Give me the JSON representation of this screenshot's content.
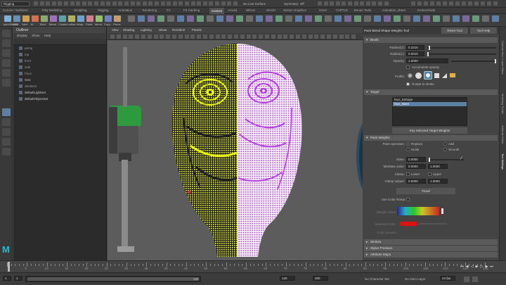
{
  "status_line": {
    "menuset": "Rigging",
    "items": [
      {
        "label": "No Live Surface"
      },
      {
        "label": "Symmetry: Off"
      }
    ]
  },
  "shelf_tabs": [
    {
      "label": "Curves / Surfaces"
    },
    {
      "label": "Poly Modeling"
    },
    {
      "label": "Sculpting"
    },
    {
      "label": "Rigging"
    },
    {
      "label": "Animation"
    },
    {
      "label": "Rendering"
    },
    {
      "label": "FX"
    },
    {
      "label": "FX Caching"
    },
    {
      "label": "Custom",
      "active": true
    },
    {
      "label": "Arnold"
    },
    {
      "label": "Bifrost"
    },
    {
      "label": "MASH"
    },
    {
      "label": "Motion Graphics"
    },
    {
      "label": "XGen"
    },
    {
      "label": "TURTLE"
    },
    {
      "label": "Bonus Tools"
    },
    {
      "label": "Animation_sheet"
    },
    {
      "label": "Embershade"
    }
  ],
  "shelf": [
    {
      "label": "paintSkinWt",
      "color": "#7fb0d8"
    },
    {
      "label": "MEL",
      "color": "#6a8fb2"
    },
    {
      "label": "Joint",
      "color": "#d0a050"
    },
    {
      "label": "IK",
      "color": "#d07050"
    },
    {
      "label": "Bind",
      "color": "#8aa870"
    },
    {
      "label": "Blend",
      "color": "#a070c0"
    },
    {
      "label": "Cluster",
      "color": "#60a0a0"
    },
    {
      "label": "Lattice",
      "color": "#b0b060"
    },
    {
      "label": "Wrap",
      "color": "#70a0d0"
    },
    {
      "label": "Paint",
      "color": "#d08090"
    },
    {
      "label": "Mirror",
      "color": "#90c070"
    },
    {
      "label": "Copy",
      "color": "#7080c0"
    },
    {
      "label": "Prune",
      "color": "#c0a070"
    }
  ],
  "outliner": {
    "title": "Outliner",
    "menu": [
      "Display",
      "Show",
      "Help"
    ],
    "rows": [
      {
        "label": "persp",
        "bright": false
      },
      {
        "label": "top",
        "bright": false
      },
      {
        "label": "front",
        "bright": false
      },
      {
        "label": "side",
        "bright": false
      },
      {
        "label": "Face",
        "bright": false
      },
      {
        "label": "Geo",
        "bright": true
      },
      {
        "label": "Skeleton",
        "bright": false
      },
      {
        "label": "defaultLightSet",
        "bright": true
      },
      {
        "label": "defaultObjectSet",
        "bright": true
      }
    ]
  },
  "viewport": {
    "menu": [
      "View",
      "Shading",
      "Lighting",
      "Show",
      "Renderer",
      "Panels"
    ]
  },
  "tool_settings": {
    "title": "Paint Blend Shape Weights Tool",
    "reset_label": "Reset Tool",
    "help_label": "Tool Help",
    "brush": {
      "header": "Brush",
      "radius_u_label": "Radius(U):",
      "radius_u": "0.2216",
      "radius_l_label": "Radius(L):",
      "radius_l": "0.0010",
      "opacity_label": "Opacity:",
      "opacity": "1.0000",
      "accumulate_label": "Accumulate opacity",
      "profile_label": "Profile:",
      "rotate_label": "Rotate to stroke"
    },
    "target": {
      "header": "Target",
      "items": [
        "face_bShape",
        "face_Base"
      ],
      "key_button": "Key Selected Target Weights"
    },
    "paint_weights": {
      "header": "Paint Weights",
      "operation_label": "Paint operation:",
      "ops": [
        "Replace",
        "Add",
        "Scale",
        "Smooth"
      ],
      "value_label": "Value:",
      "value": "0.0000",
      "minmax_label": "Min/Max value:",
      "min": "0.0000",
      "max": "1.0000",
      "clamp_label": "Clamp:",
      "clamp_lower": "Lower",
      "clamp_upper": "Upper",
      "clamp_values_label": "Clamp values:",
      "clamp_min": "0.0000",
      "clamp_max": "1.0000",
      "flood_label": "Flood",
      "color_ramp_label": "Use Color Ramp",
      "weight_colors_label": "Weight colors:",
      "selected_color_label": "Selected Color:",
      "color_presets_label": "Color presets:",
      "selected_color": "#e01010"
    },
    "closed_sections": [
      "Strokes",
      "Stylus Pressure",
      "Attribute Maps"
    ]
  },
  "channel_tabs": [
    "Channel Box / Layer Editor",
    "Modeling Toolkit",
    "Attribute Editor",
    "Tool Settings"
  ],
  "time_slider": {
    "ticks": [
      "5",
      "10",
      "15",
      "20",
      "25",
      "30",
      "35",
      "40",
      "45",
      "50",
      "55",
      "60",
      "65",
      "70",
      "75",
      "80",
      "85",
      "90",
      "95",
      "100",
      "105",
      "110",
      "115",
      "120"
    ],
    "current_frame": "1"
  },
  "range": {
    "start": "1",
    "inner_start": "1",
    "inner_end": "120",
    "end": "120",
    "end2": "200",
    "character_set": "No Character Set",
    "anim_layer": "No Anim Layer",
    "fps": "24 fps"
  },
  "colors": {
    "accent_yellow": "#eaf21a",
    "accent_magenta": "#c93fe6",
    "selection_blue": "#5d7fa3"
  }
}
